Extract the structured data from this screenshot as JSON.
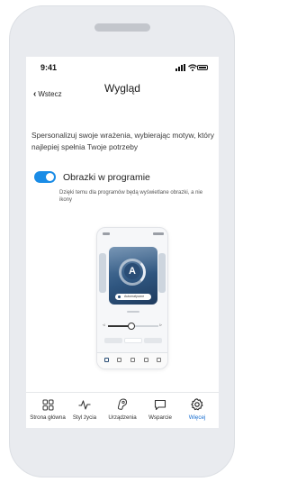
{
  "status_bar": {
    "time": "9:41"
  },
  "header": {
    "back_label": "Wstecz",
    "title": "Wygląd"
  },
  "intro_text": "Spersonalizuj swoje wrażenia, wybierając motyw, który najlepiej spełnia Twoje potrzeby",
  "setting": {
    "label": "Obrazki w programie",
    "enabled": true,
    "description": "Dzięki temu dla programów będą wyświetlane obrazki, a nie ikony"
  },
  "preview": {
    "program_letter": "A",
    "program_name": "Automatyczne"
  },
  "bottom_nav": {
    "items": [
      {
        "label": "Strona główna",
        "icon": "home-grid-icon",
        "active": false
      },
      {
        "label": "Styl życia",
        "icon": "activity-icon",
        "active": false
      },
      {
        "label": "Urządzenia",
        "icon": "hearing-aid-icon",
        "active": false
      },
      {
        "label": "Wsparcie",
        "icon": "chat-bubble-icon",
        "active": false
      },
      {
        "label": "Więcej",
        "icon": "gear-icon",
        "active": true
      }
    ]
  },
  "colors": {
    "accent": "#1a8ce6",
    "active_nav": "#1a6fd0"
  }
}
